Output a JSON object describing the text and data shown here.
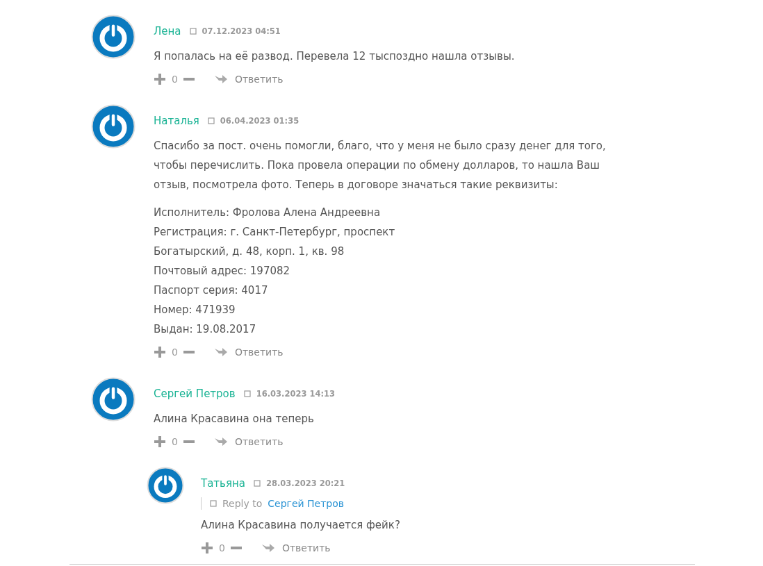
{
  "comments": [
    {
      "author": "Лена",
      "date": "07.12.2023 04:51",
      "paragraphs": [
        [
          "Я попалась на её развод. Перевела 12 тыспоздно нашла отзывы."
        ]
      ],
      "votes": "0",
      "reply_label": "Ответить",
      "nested": false
    },
    {
      "author": "Наталья",
      "date": "06.04.2023 01:35",
      "paragraphs": [
        [
          "Спасибо за пост. очень помогли, благо, что у меня не было сразу денег для того, чтобы перечислить. Пока провела операции по обмену долларов, то нашла Ваш отзыв, посмотрела фото. Теперь в договоре значаться такие реквизиты:"
        ],
        [
          "Исполнитель: Фролова Алена Андреевна",
          "Регистрация: г. Санкт-Петербург, проспект",
          "Богатырский, д. 48, корп. 1, кв. 98",
          "Почтовый адрес: 197082",
          "Паспорт серия: 4017",
          "Номер: 471939",
          "Выдан: 19.08.2017"
        ]
      ],
      "votes": "0",
      "reply_label": "Ответить",
      "nested": false
    },
    {
      "author": "Сергей Петров",
      "date": "16.03.2023 14:13",
      "paragraphs": [
        [
          "Алина Красавина она теперь"
        ]
      ],
      "votes": "0",
      "reply_label": "Ответить",
      "nested": false
    },
    {
      "author": "Татьяна",
      "date": "28.03.2023 20:21",
      "reply_to": {
        "label": "Reply to",
        "name": "Сергей Петров"
      },
      "paragraphs": [
        [
          "Алина Красавина получается фейк?"
        ]
      ],
      "votes": "0",
      "reply_label": "Ответить",
      "nested": true
    }
  ]
}
